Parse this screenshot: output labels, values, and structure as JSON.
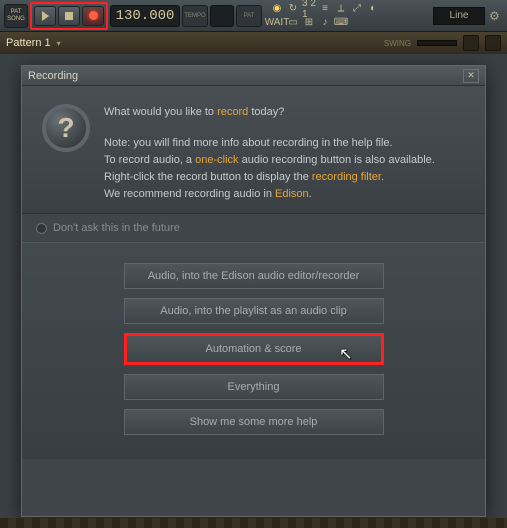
{
  "toolbar": {
    "pat_label": "PAT",
    "song_label": "SONG",
    "tempo_value": "130.000",
    "tempo_label": "TEMPO",
    "pat_small": "PAT",
    "countdown_label": "3 2 1",
    "wait_label": "WAIT",
    "line_mode": "Line"
  },
  "pattern": {
    "name": "Pattern 1",
    "swing_label": "SWING"
  },
  "dialog": {
    "title": "Recording",
    "question_prefix": "What would you like to ",
    "question_hl": "record",
    "question_suffix": " today?",
    "note1": "Note: you will find more info about recording in the help file.",
    "note2a": "To record audio, a ",
    "note2b": "one-click",
    "note2c": " audio recording button is also available.",
    "note3a": "Right-click the record button to display the ",
    "note3b": "recording filter",
    "note3c": ".",
    "note4a": "We recommend recording audio in ",
    "note4b": "Edison",
    "note4c": ".",
    "dont_ask": "Don't ask this in the future",
    "buttons": [
      "Audio, into the Edison audio editor/recorder",
      "Audio, into the playlist as an audio clip",
      "Automation & score",
      "Everything",
      "Show me some more help"
    ]
  }
}
